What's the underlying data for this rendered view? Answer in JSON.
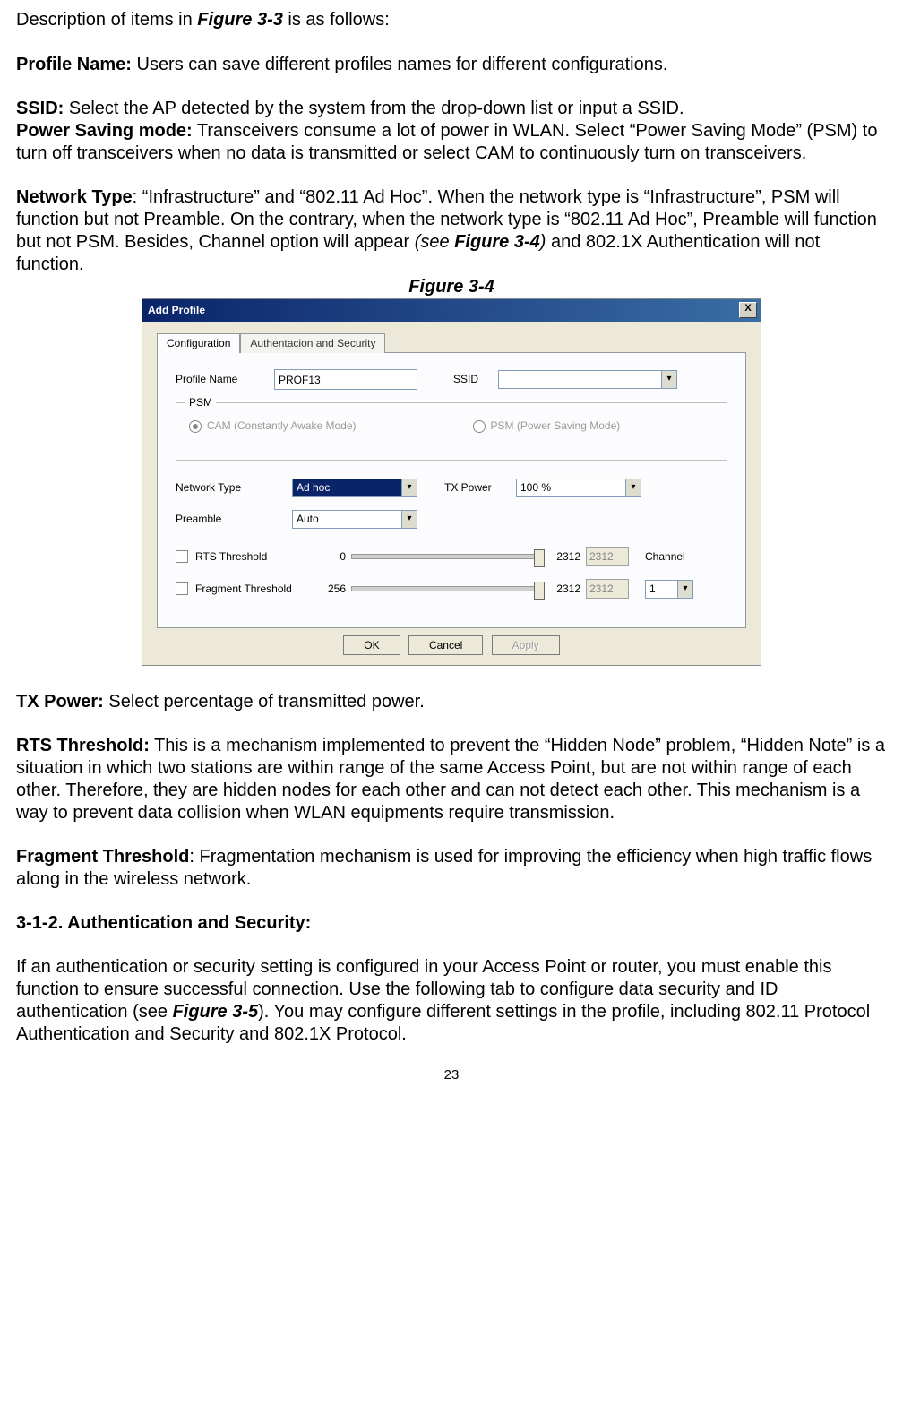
{
  "intro": {
    "line1_pre": "Description of items in ",
    "line1_ref": "Figure 3-3",
    "line1_post": " is as follows:"
  },
  "defs": {
    "profile_name": {
      "label": "Profile Name:",
      "text": " Users can save different profiles names for different configurations."
    },
    "ssid": {
      "label": "SSID:",
      "text": " Select the AP detected by the system from the drop-down list or input a SSID."
    },
    "psm": {
      "label": "Power Saving mode:",
      "text": " Transceivers consume a lot of power in WLAN. Select “Power Saving Mode” (PSM) to turn off transceivers when no data is transmitted or select CAM to continuously turn on transceivers."
    },
    "network_type": {
      "label": "Network Type",
      "text_a": ": “Infrastructure” and “802.11 Ad Hoc”. When the network type is “Infrastructure”, PSM will function but not Preamble. On the contrary, when the network type is “802.11 Ad Hoc”, Preamble will function but not PSM. Besides, Channel option will appear ",
      "see": "(see ",
      "figref": "Figure 3-4",
      "see_end": ")",
      "text_b": " and 802.1X Authentication will not function."
    },
    "tx_power": {
      "label": "TX Power:",
      "text": " Select percentage of transmitted power."
    },
    "rts": {
      "label": "RTS Threshold:",
      "text": " This is a mechanism implemented to prevent the “Hidden Node” problem, “Hidden Note” is a situation in which two stations are within range of the same Access Point, but are not within range of each other. Therefore, they are hidden nodes for each other and can not detect each other. This mechanism is a way to prevent data collision when WLAN equipments require transmission."
    },
    "frag": {
      "label": "Fragment Threshold",
      "text": ": Fragmentation mechanism is used for improving the efficiency when high traffic flows along in the wireless network."
    }
  },
  "section": {
    "num": "3-1-2.",
    "title": "Authentication and Security:"
  },
  "auth_para": {
    "pre": "If an authentication or security setting is configured in your Access Point or router, you must enable this function to ensure successful connection. Use the following tab to configure data security and ID authentication (see ",
    "figref": "Figure 3-5",
    "post": "). You may configure different settings in the profile, including 802.11 Protocol Authentication and Security and 802.1X Protocol."
  },
  "figure_caption": "Figure 3-4",
  "page_number": "23",
  "dialog": {
    "title": "Add Profile",
    "close": "X",
    "tabs": {
      "config": "Configuration",
      "auth": "Authentacion and Security"
    },
    "labels": {
      "profile_name": "Profile Name",
      "ssid": "SSID",
      "psm_group": "PSM",
      "cam": "CAM (Constantly Awake Mode)",
      "psm": "PSM (Power Saving Mode)",
      "network_type": "Network Type",
      "tx_power": "TX Power",
      "preamble": "Preamble",
      "rts": "RTS Threshold",
      "fragment": "Fragment Threshold",
      "channel": "Channel"
    },
    "values": {
      "profile_name": "PROF13",
      "ssid": "",
      "network_type": "Ad hoc",
      "tx_power": "100 %",
      "preamble": "Auto",
      "rts_min": "0",
      "rts_max": "2312",
      "rts_val": "2312",
      "frag_min": "256",
      "frag_max": "2312",
      "frag_val": "2312",
      "channel": "1"
    },
    "buttons": {
      "ok": "OK",
      "cancel": "Cancel",
      "apply": "Apply"
    }
  }
}
